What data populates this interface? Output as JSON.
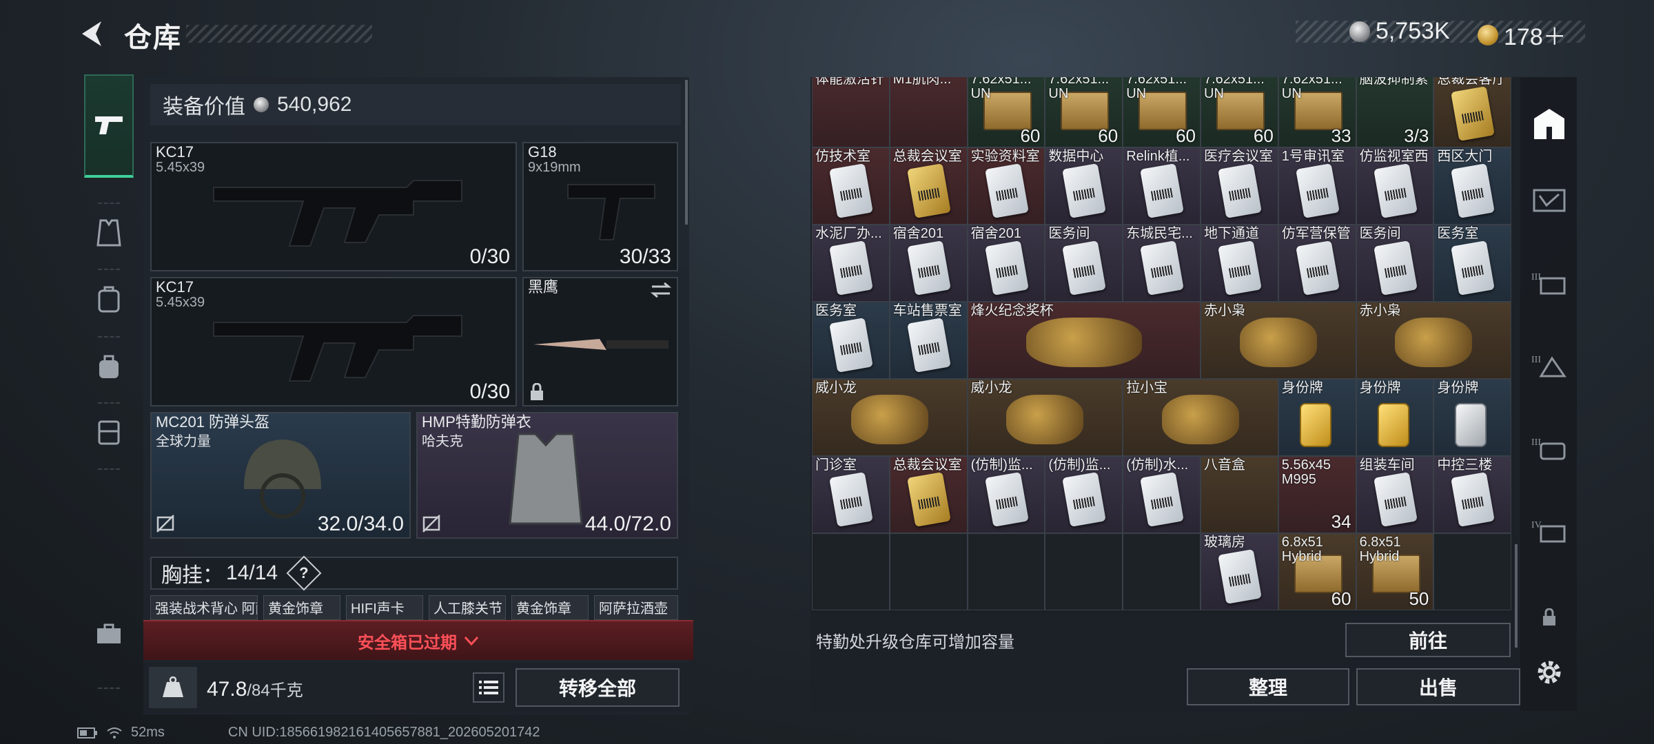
{
  "header": {
    "title": "仓库",
    "silver": "5,753K",
    "gold": "178＋"
  },
  "equipment": {
    "value_label": "装备价值",
    "value": "540,962",
    "primary1": {
      "name": "KC17",
      "caliber": "5.45x39",
      "ammo": "0/30"
    },
    "sidearm": {
      "name": "G18",
      "caliber": "9x19mm",
      "ammo": "30/33"
    },
    "primary2": {
      "name": "KC17",
      "caliber": "5.45x39",
      "ammo": "0/30"
    },
    "melee": {
      "name": "黑鹰"
    },
    "helmet": {
      "name": "MC201 防弹头盔",
      "sub": "全球力量",
      "dur": "32.0/34.0"
    },
    "armor": {
      "name": "HMP特勤防弹衣",
      "sub": "哈夫克",
      "dur": "44.0/72.0"
    },
    "chest_rig": {
      "label": "胸挂：",
      "count": "14/14",
      "help": "?"
    },
    "rig_items": [
      "强装战术背心 阿萨拉",
      "黄金饰章",
      "HIFI声卡",
      "人工膝关节",
      "黄金饰章",
      "阿萨拉酒壶"
    ]
  },
  "safebox": {
    "text": "安全箱已过期"
  },
  "bottom": {
    "weight": "47.8",
    "weight_cap": "/84千克",
    "transfer": "转移全部"
  },
  "status": {
    "ping": "52ms",
    "uid": "CN UID:18566198216140565788​1_202605201742"
  },
  "warehouse": {
    "rows": [
      [
        {
          "t": "体能激活针",
          "c": "r"
        },
        {
          "t": "M1肌肉...",
          "c": "r"
        },
        {
          "t": "7.62x51...",
          "t2": "UN",
          "c": "g",
          "q": "60",
          "k": "ammo"
        },
        {
          "t": "7.62x51...",
          "t2": "UN",
          "c": "g",
          "q": "60",
          "k": "ammo"
        },
        {
          "t": "7.62x51...",
          "t2": "UN",
          "c": "g",
          "q": "60",
          "k": "ammo"
        },
        {
          "t": "7.62x51...",
          "t2": "UN",
          "c": "g",
          "q": "60",
          "k": "ammo"
        },
        {
          "t": "7.62x51...",
          "t2": "UN",
          "c": "g",
          "q": "33",
          "k": "ammo"
        },
        {
          "t": "脑波抑制素",
          "c": "g",
          "q": "3/3"
        },
        {
          "t": "总裁会客厅",
          "c": "o",
          "k": "goldcard"
        }
      ],
      [
        {
          "t": "仿技术室",
          "c": "r",
          "k": "card"
        },
        {
          "t": "总裁会议室",
          "c": "r",
          "k": "goldcard"
        },
        {
          "t": "实验资料室",
          "c": "r",
          "k": "card"
        },
        {
          "t": "数据中心",
          "c": "p",
          "k": "card"
        },
        {
          "t": "Relink植...",
          "c": "p",
          "k": "card"
        },
        {
          "t": "医疗会议室",
          "c": "p",
          "k": "card"
        },
        {
          "t": "1号审讯室",
          "c": "p",
          "k": "card"
        },
        {
          "t": "仿监视室西",
          "c": "p",
          "k": "card"
        },
        {
          "t": "西区大门",
          "c": "b",
          "k": "card"
        }
      ],
      [
        {
          "t": "水泥厂办...",
          "c": "p",
          "k": "card"
        },
        {
          "t": "宿舍201",
          "c": "p",
          "k": "card"
        },
        {
          "t": "宿舍201",
          "c": "p",
          "k": "card"
        },
        {
          "t": "医务间",
          "c": "p",
          "k": "card"
        },
        {
          "t": "东城民宅...",
          "c": "p",
          "k": "card"
        },
        {
          "t": "地下通道",
          "c": "p",
          "k": "card"
        },
        {
          "t": "仿军营保管",
          "c": "p",
          "k": "card"
        },
        {
          "t": "医务间",
          "c": "p",
          "k": "card"
        },
        {
          "t": "医务室",
          "c": "b",
          "k": "card"
        }
      ],
      [
        {
          "t": "医务室",
          "c": "b",
          "k": "card"
        },
        {
          "t": "车站售票室",
          "c": "b",
          "k": "card"
        },
        {
          "t": "烽火纪念奖杯",
          "c": "r",
          "w": 3
        },
        {
          "t": "赤小枭",
          "c": "o",
          "w": 2
        },
        {
          "t": "赤小枭",
          "c": "o",
          "w": 2
        }
      ],
      [
        {
          "t": "威小龙",
          "c": "o",
          "w": 2
        },
        {
          "t": "威小龙",
          "c": "o",
          "w": 2
        },
        {
          "t": "拉小宝",
          "c": "o",
          "w": 2
        },
        {
          "t": "身份牌",
          "c": "b",
          "k": "tag"
        },
        {
          "t": "身份牌",
          "c": "b",
          "k": "tag"
        },
        {
          "t": "身份牌",
          "c": "b",
          "k": "stag"
        }
      ],
      [
        {
          "t": "门诊室",
          "c": "p",
          "k": "card"
        },
        {
          "t": "总裁会议室",
          "c": "r",
          "k": "goldcard"
        },
        {
          "t": "(仿制)监...",
          "c": "p",
          "k": "card"
        },
        {
          "t": "(仿制)监...",
          "c": "p",
          "k": "card"
        },
        {
          "t": "(仿制)水...",
          "c": "p",
          "k": "card"
        },
        {
          "t": "八音盒",
          "c": "o"
        },
        {
          "t": "5.56x45",
          "t2": "M995",
          "c": "r",
          "q": "34"
        },
        {
          "t": "组装车间",
          "c": "p",
          "k": "card"
        },
        {
          "t": "中控三楼",
          "c": "p",
          "k": "card"
        }
      ],
      [
        {
          "t": "",
          "c": "e"
        },
        {
          "t": "",
          "c": "e"
        },
        {
          "t": "",
          "c": "e"
        },
        {
          "t": "",
          "c": "e"
        },
        {
          "t": "",
          "c": "e"
        },
        {
          "t": "玻璃房",
          "c": "p",
          "k": "card"
        },
        {
          "t": "6.8x51",
          "t2": "Hybrid",
          "c": "o",
          "q": "60",
          "k": "ammo"
        },
        {
          "t": "6.8x51",
          "t2": "Hybrid",
          "c": "o",
          "q": "50",
          "k": "ammo"
        },
        {
          "t": "",
          "c": "e"
        }
      ]
    ],
    "upgrade_note": "特勤处升级仓库可增加容量",
    "goto": "前往",
    "sort": "整理",
    "sell": "出售"
  },
  "icons": [
    "back-icon",
    "pistol-icon",
    "vest-icon",
    "backpack-icon",
    "bag-icon",
    "case-icon",
    "toolbox-icon",
    "home-icon",
    "settings-icon",
    "lock-icon"
  ]
}
